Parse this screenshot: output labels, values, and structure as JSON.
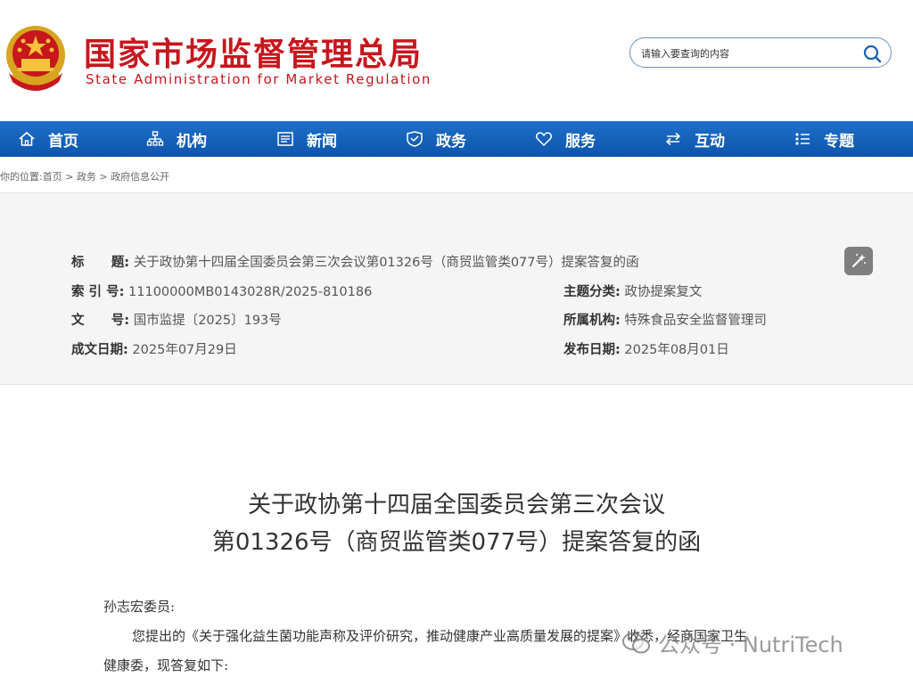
{
  "header": {
    "site_name_cn": "国家市场监督管理总局",
    "site_name_en": "State Administration for Market Regulation",
    "search_placeholder": "请输入要查询的内容"
  },
  "nav": {
    "items": [
      {
        "label": "首页",
        "icon": "home-icon"
      },
      {
        "label": "机构",
        "icon": "org-chart-icon"
      },
      {
        "label": "新闻",
        "icon": "news-icon"
      },
      {
        "label": "政务",
        "icon": "shield-icon"
      },
      {
        "label": "服务",
        "icon": "heart-icon"
      },
      {
        "label": "互动",
        "icon": "exchange-icon"
      },
      {
        "label": "专题",
        "icon": "list-icon"
      }
    ]
  },
  "breadcrumb": {
    "prefix": "你的位置:",
    "items": [
      "首页",
      "政务",
      "政府信息公开"
    ],
    "separator": " > "
  },
  "info": {
    "title_label": "标      题:",
    "title_value": "关于政协第十四届全国委员会第三次会议第01326号（商贸监管类077号）提案答复的函",
    "index_label": "索 引 号:",
    "index_value": "11100000MB0143028R/2025-810186",
    "topic_label": "主题分类:",
    "topic_value": "政协提案复文",
    "docno_label": "文      号:",
    "docno_value": "国市监提〔2025〕193号",
    "org_label": "所属机构:",
    "org_value": "特殊食品安全监督管理司",
    "date_label": "成文日期:",
    "date_value": "2025年07月29日",
    "pub_label": "发布日期:",
    "pub_value": "2025年08月01日"
  },
  "article": {
    "title_line1": "关于政协第十四届全国委员会第三次会议",
    "title_line2": "第01326号（商贸监管类077号）提案答复的函",
    "salutation": "孙志宏委员:",
    "para1_line1": "您提出的《关于强化益生菌功能声称及评价研究，推动健康产业高质量发展的提案》收悉，经商国家卫生",
    "para1_line2": "健康委，现答复如下:"
  },
  "watermark": {
    "text": "公众号 · NutriTech"
  },
  "colors": {
    "brand_red": "#c8161d",
    "nav_blue": "#0c55ac",
    "panel_gray": "#f5f5f5"
  }
}
